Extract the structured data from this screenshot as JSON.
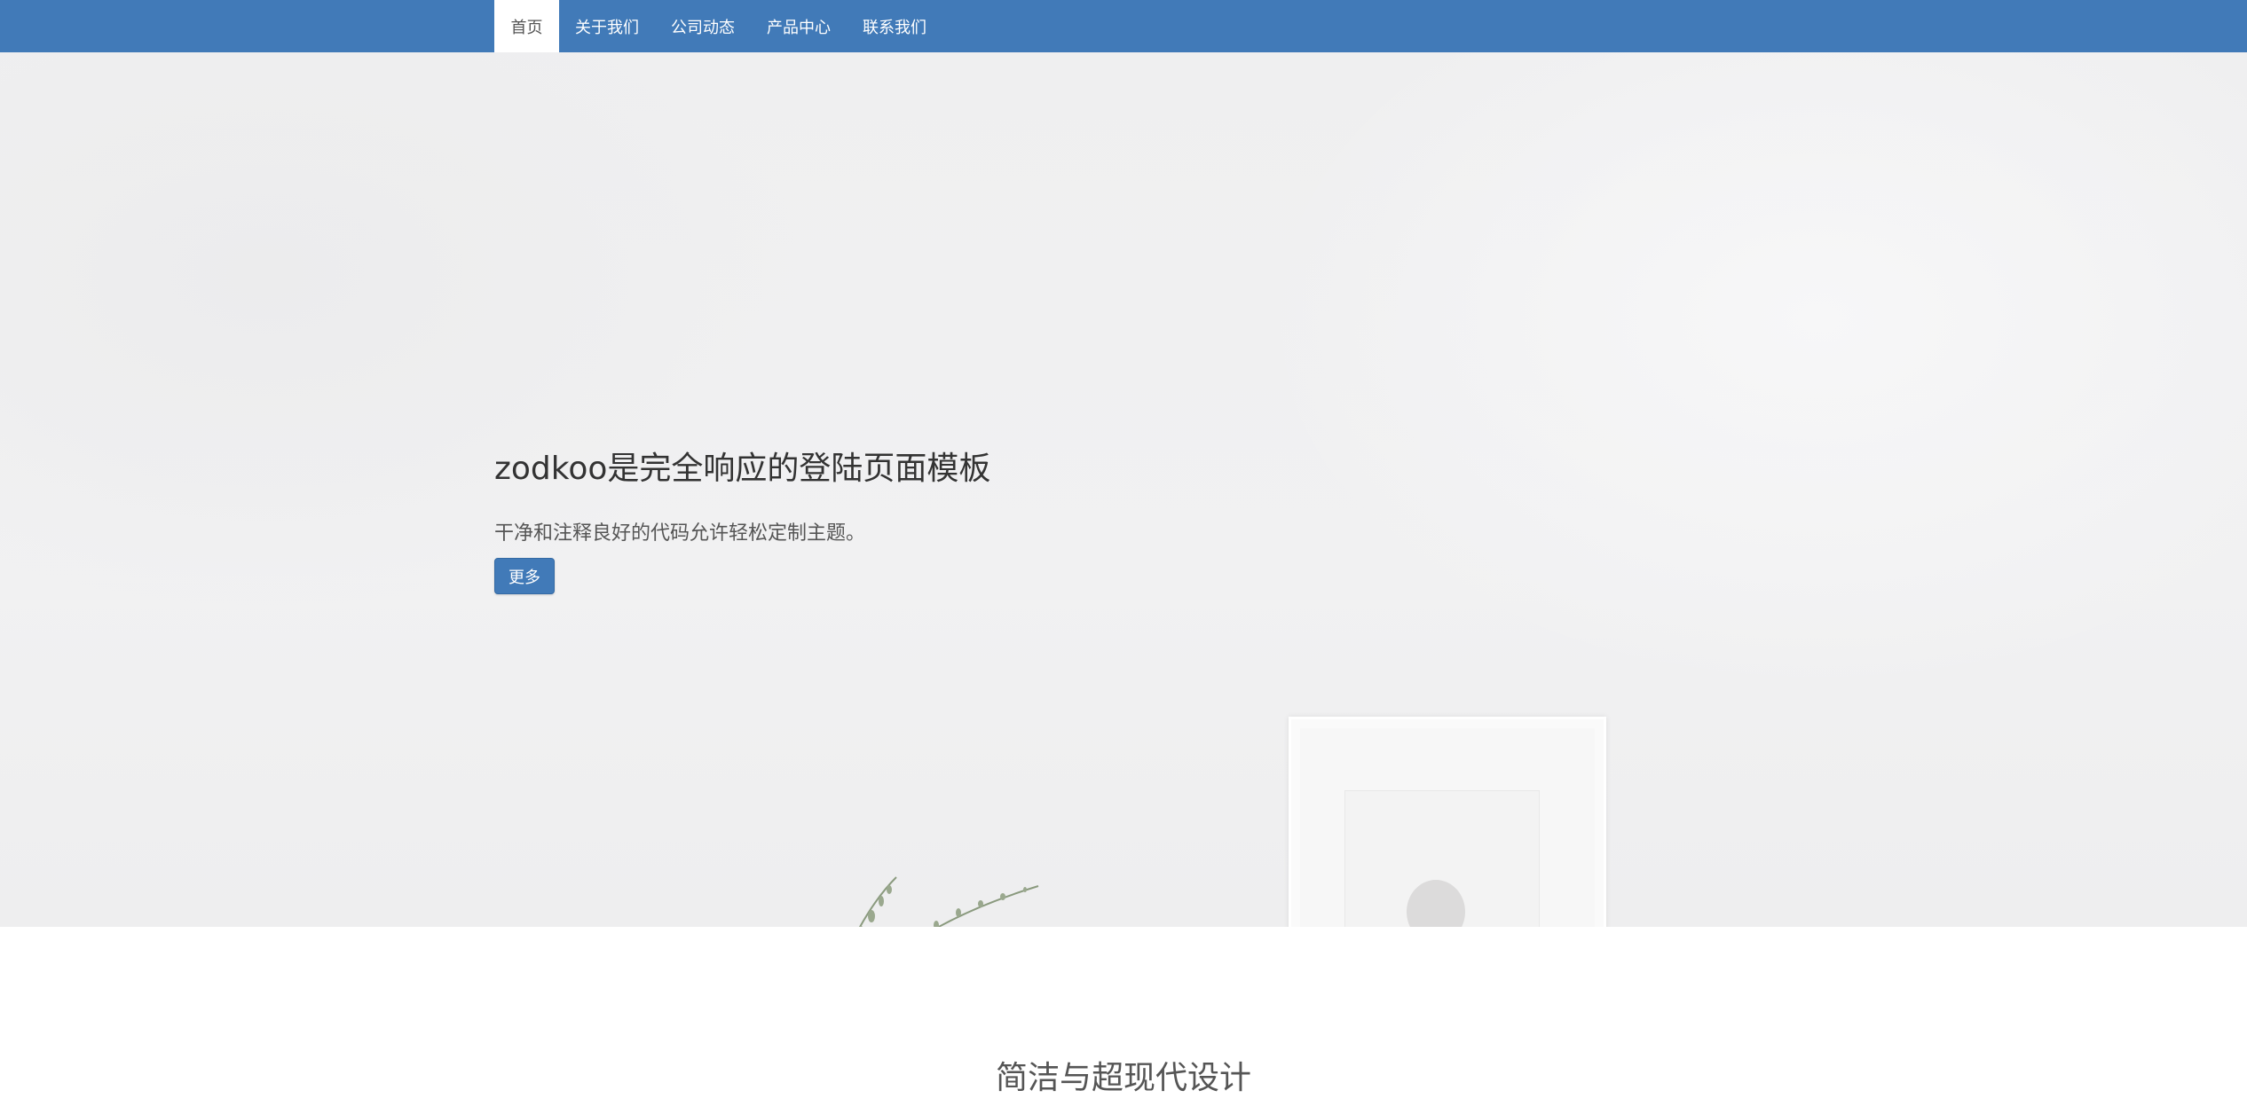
{
  "navbar": {
    "items": [
      {
        "label": "首页",
        "active": true
      },
      {
        "label": "关于我们",
        "active": false
      },
      {
        "label": "公司动态",
        "active": false
      },
      {
        "label": "产品中心",
        "active": false
      },
      {
        "label": "联系我们",
        "active": false
      }
    ],
    "background_color": "#417ab8"
  },
  "hero": {
    "title": "zodkoo是完全响应的登陆页面模板",
    "subtitle": "干净和注释良好的代码允许轻松定制主题。",
    "button_label": "更多"
  },
  "section": {
    "title": "简洁与超现代设计"
  }
}
